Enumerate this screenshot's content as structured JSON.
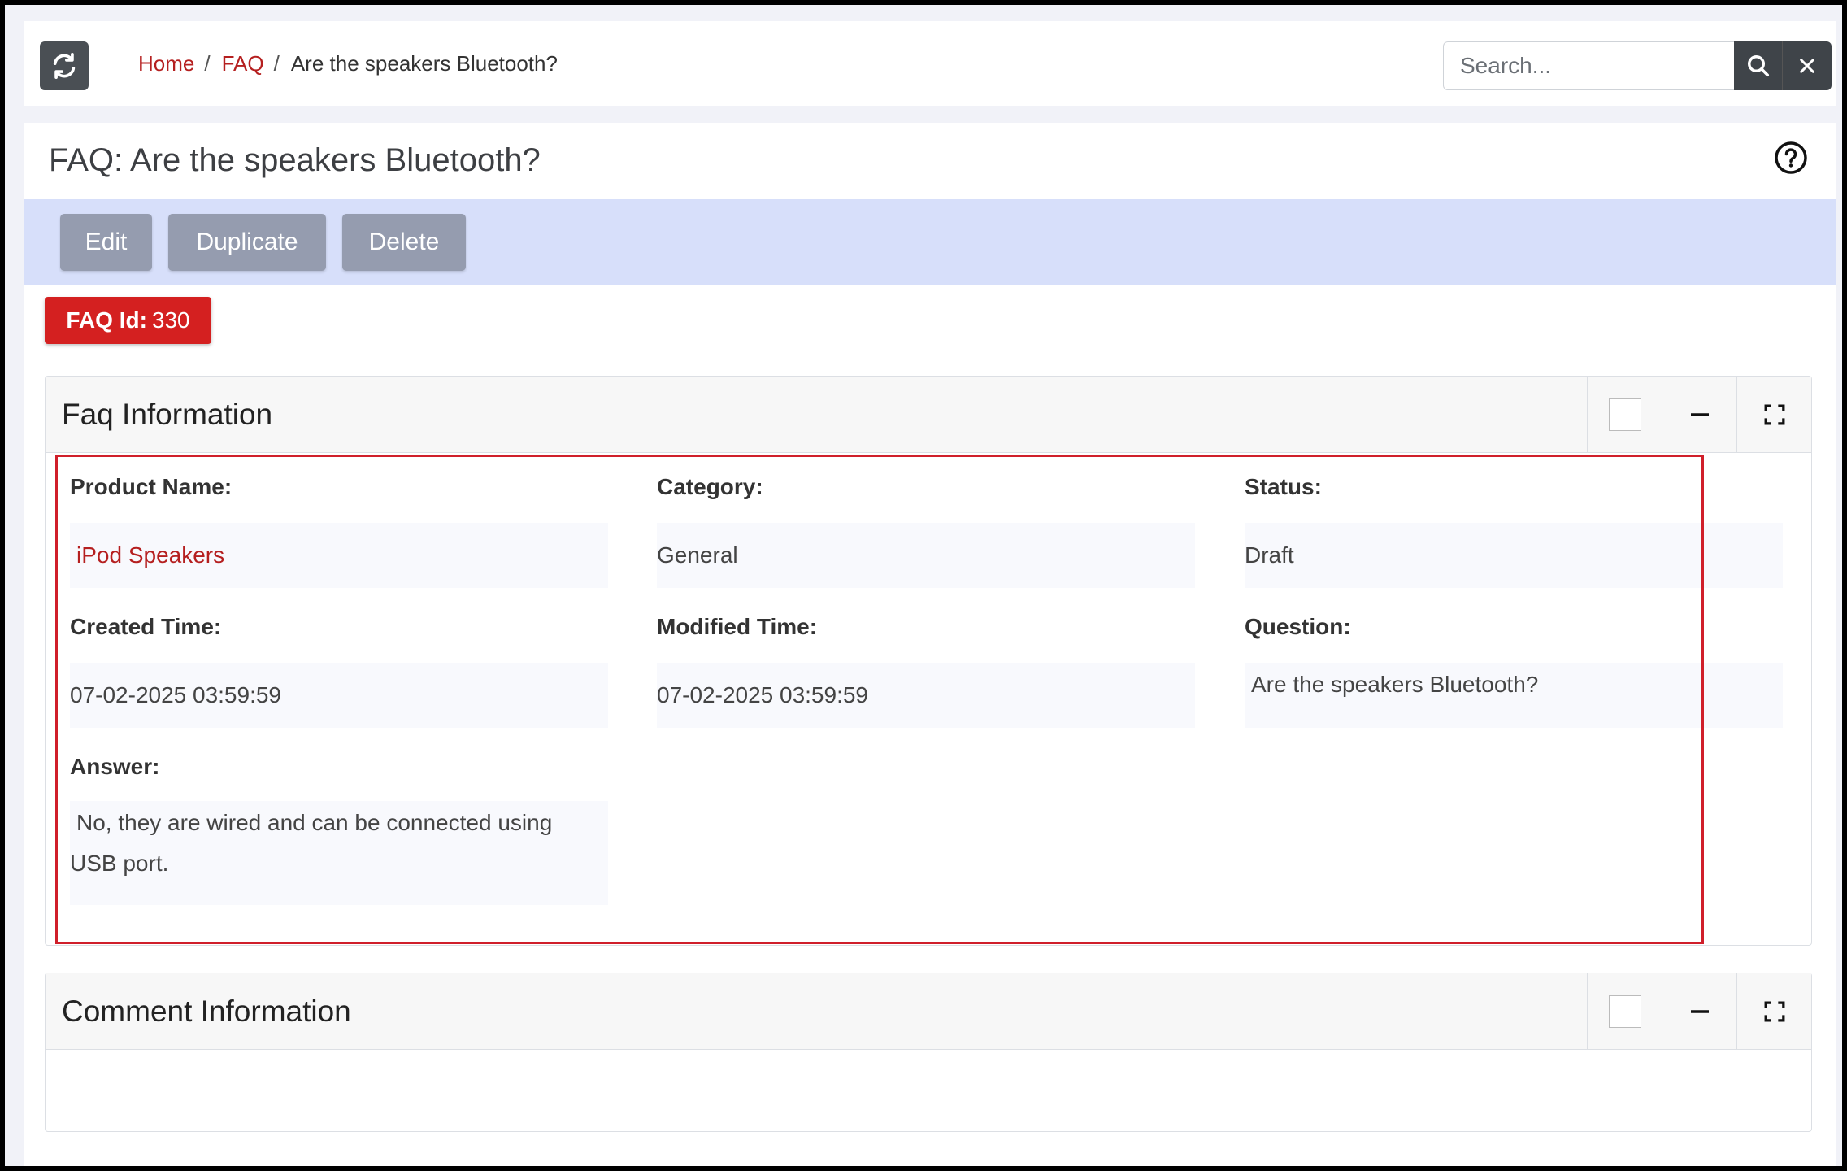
{
  "breadcrumb": {
    "home": "Home",
    "faq": "FAQ",
    "current": "Are the speakers Bluetooth?"
  },
  "search": {
    "placeholder": "Search...",
    "value": ""
  },
  "page": {
    "title": "FAQ: Are the speakers Bluetooth?"
  },
  "toolbar": {
    "edit_label": "Edit",
    "duplicate_label": "Duplicate",
    "delete_label": "Delete"
  },
  "badge": {
    "label": "FAQ Id:",
    "value": "330"
  },
  "faq_card": {
    "title": "Faq Information",
    "fields": {
      "product_name": {
        "label": "Product Name:",
        "value": "iPod Speakers"
      },
      "category": {
        "label": "Category:",
        "value": "General"
      },
      "status": {
        "label": "Status:",
        "value": "Draft"
      },
      "created_time": {
        "label": "Created Time:",
        "value": "07-02-2025 03:59:59"
      },
      "modified_time": {
        "label": "Modified Time:",
        "value": "07-02-2025 03:59:59"
      },
      "question": {
        "label": "Question:",
        "value": "Are the speakers Bluetooth?"
      },
      "answer": {
        "label": "Answer:",
        "value_line1": "No, they are wired and can be connected using",
        "value_line2": "USB port."
      }
    }
  },
  "comment_card": {
    "title": "Comment Information"
  },
  "colors": {
    "accent_red": "#d42020",
    "link_red": "#b51f1f",
    "toolbar_bg": "#d7dffa",
    "button_bg": "#959caf",
    "dark_button": "#3f4449"
  },
  "icons": {
    "refresh": "refresh-icon",
    "search": "search-icon",
    "clear": "close-icon",
    "help": "help-circle-icon",
    "minimize": "minus-icon",
    "fullscreen": "expand-icon"
  }
}
